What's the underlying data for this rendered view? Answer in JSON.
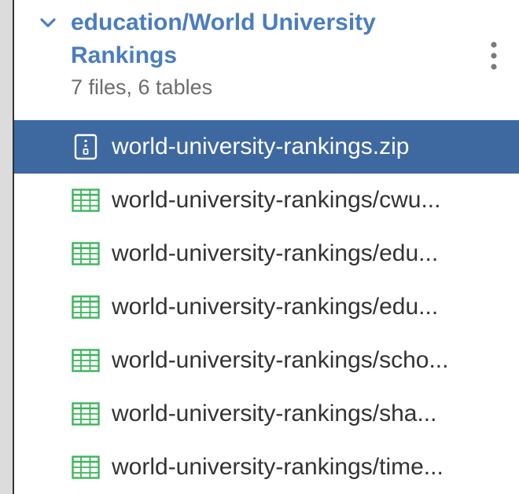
{
  "dataset": {
    "title": "education/World University Rankings",
    "summary": "7 files, 6 tables",
    "expand_icon": "chevron-down-icon",
    "menu_icon": "kebab-menu-icon"
  },
  "colors": {
    "accent": "#4a7dbf",
    "selected_bg": "#3e68a0",
    "table_icon": "#3cb55a"
  },
  "files": [
    {
      "label": "world-university-rankings.zip",
      "icon": "zip-file-icon",
      "selected": true
    },
    {
      "label": "world-university-rankings/cwu...",
      "icon": "table-icon",
      "selected": false
    },
    {
      "label": "world-university-rankings/edu...",
      "icon": "table-icon",
      "selected": false
    },
    {
      "label": "world-university-rankings/edu...",
      "icon": "table-icon",
      "selected": false
    },
    {
      "label": "world-university-rankings/scho...",
      "icon": "table-icon",
      "selected": false
    },
    {
      "label": "world-university-rankings/sha...",
      "icon": "table-icon",
      "selected": false
    },
    {
      "label": "world-university-rankings/time...",
      "icon": "table-icon",
      "selected": false
    }
  ]
}
